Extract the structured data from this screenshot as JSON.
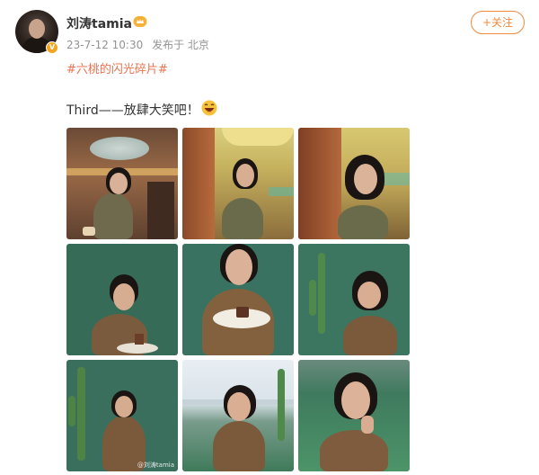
{
  "user": {
    "name": "刘涛tamia",
    "time": "23-7-12 10:30",
    "source": "发布于 北京"
  },
  "follow_label": "+关注",
  "topic": "#六桃的闪光碎片#",
  "text": "Third——放肆大笑吧！",
  "emoji": "laughing-emoji",
  "photos": [
    {
      "scene": "restaurant"
    },
    {
      "scene": "doorway"
    },
    {
      "scene": "doorway-close"
    },
    {
      "scene": "green-wall-eating"
    },
    {
      "scene": "green-wall-plate"
    },
    {
      "scene": "cactus-eating"
    },
    {
      "scene": "cactus-sitting"
    },
    {
      "scene": "outdoor-sea"
    },
    {
      "scene": "court-smile"
    }
  ],
  "watermark": "@刘涛tamia",
  "colors": {
    "accent": "#f08a3e",
    "topic": "#eb7350",
    "meta": "#939393"
  }
}
